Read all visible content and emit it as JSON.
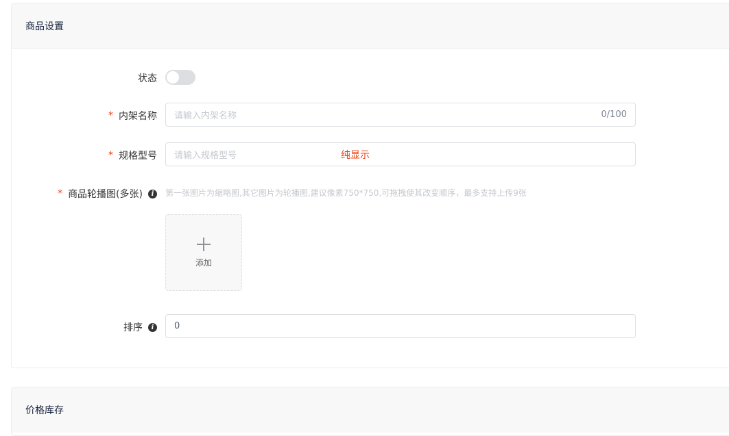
{
  "sections": {
    "product_settings_title": "商品设置",
    "price_stock_title": "价格库存"
  },
  "form": {
    "status": {
      "label": "状态",
      "enabled": false
    },
    "listing_name": {
      "required_mark": "*",
      "label": "内架名称",
      "placeholder": "请输入内架名称",
      "counter": "0/100"
    },
    "spec_model": {
      "required_mark": "*",
      "label": "规格型号",
      "placeholder": "请输入规格型号",
      "note": "纯显示"
    },
    "carousel": {
      "required_mark": "*",
      "label": "商品轮播图(多张)",
      "info_icon": "i",
      "hint": "第一张图片为缩略图,其它图片为轮播图,建议像素750*750,可拖拽使其改变顺序，最多支持上传9张",
      "upload_label": "添加"
    },
    "sort": {
      "label": "排序",
      "info_icon": "i",
      "value": "0"
    }
  },
  "colors": {
    "required": "#ed4014",
    "border": "#dcdee2",
    "header_bg": "#f8f8f9"
  }
}
